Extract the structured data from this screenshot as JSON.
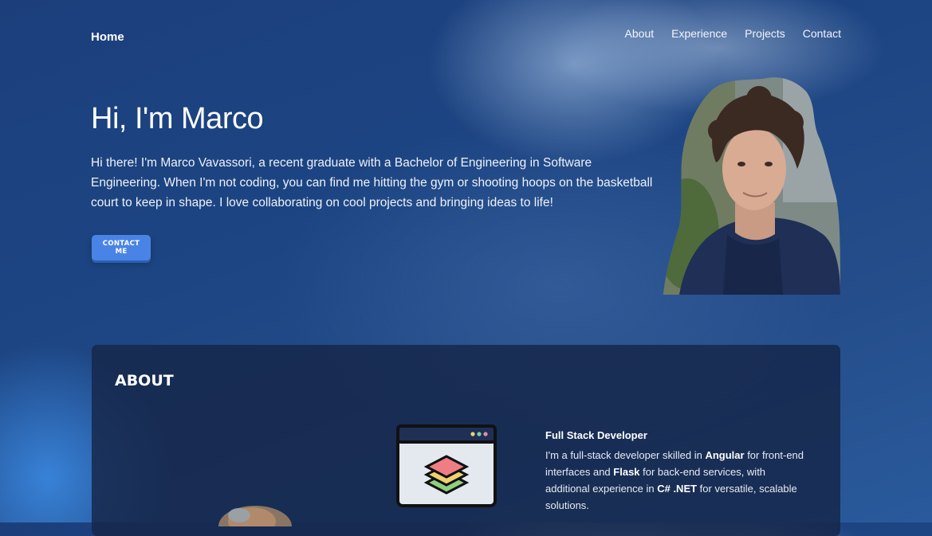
{
  "nav": {
    "home": "Home",
    "links": [
      "About",
      "Experience",
      "Projects",
      "Contact"
    ]
  },
  "hero": {
    "title": "Hi, I'm Marco",
    "description": "Hi there! I'm Marco Vavassori, a recent graduate with a Bachelor of Engineering in Software Engineering. When I'm not coding, you can find me hitting the gym or shooting hoops on the basketball court to keep in shape. I love collaborating on cool projects and bringing ideas to life!",
    "button": "CONTACT ME"
  },
  "about": {
    "heading": "ABOUT",
    "feature": {
      "title": "Full Stack Developer",
      "desc_1": "I'm a full-stack developer skilled in ",
      "bold_1": "Angular",
      "desc_2": " for front-end interfaces and ",
      "bold_2": "Flask",
      "desc_3": " for back-end services, with additional experience in ",
      "bold_3": "C# .NET",
      "desc_4": " for versatile, scalable solutions."
    }
  },
  "colors": {
    "accent": "#4a83e6",
    "card": "#162648",
    "background": "#1d4583"
  },
  "icons": {
    "feature_icon": "browser-window-layers-icon"
  }
}
